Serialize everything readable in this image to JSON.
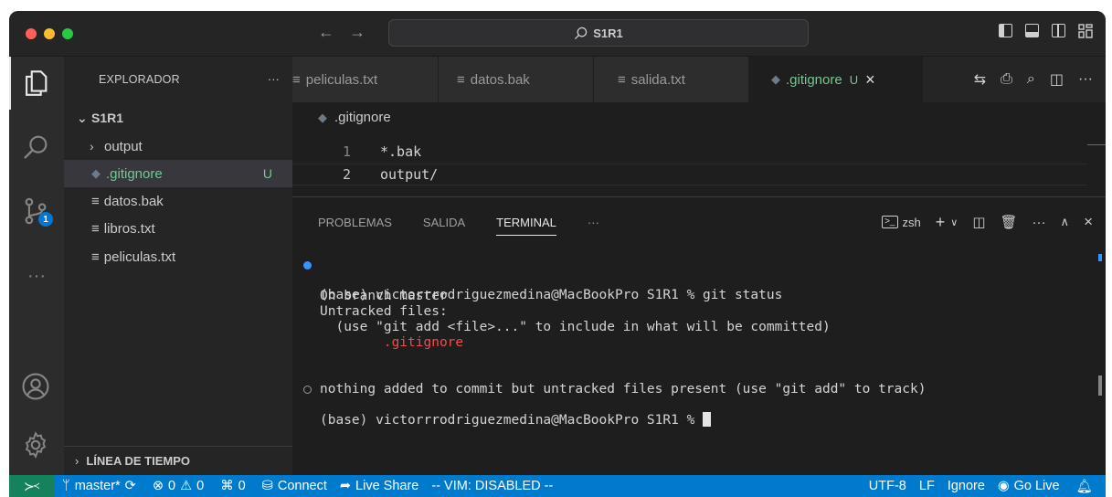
{
  "window": {
    "traffic_colors": [
      "#ff5f57",
      "#febc2e",
      "#28c840"
    ],
    "search_text": "S1R1"
  },
  "sidebar": {
    "title": "EXPLORADOR",
    "more": "···",
    "root": "S1R1",
    "items": [
      {
        "label": "output",
        "type": "folder"
      },
      {
        "label": ".gitignore",
        "type": "git",
        "badge": "U"
      },
      {
        "label": "datos.bak",
        "type": "file"
      },
      {
        "label": "libros.txt",
        "type": "file"
      },
      {
        "label": "peliculas.txt",
        "type": "file"
      }
    ],
    "timeline": "LÍNEA DE TIEMPO"
  },
  "activity": {
    "scm_badge": "1"
  },
  "tabs": [
    {
      "label": "peliculas.txt"
    },
    {
      "label": "datos.bak"
    },
    {
      "label": "salida.txt"
    },
    {
      "label": ".gitignore",
      "badge": "U",
      "close": "×"
    }
  ],
  "editor": {
    "breadcrumb": ".gitignore",
    "lines": [
      {
        "num": "1",
        "text": "*.bak"
      },
      {
        "num": "2",
        "text": "output/"
      }
    ]
  },
  "panel": {
    "tabs": [
      "PROBLEMAS",
      "SALIDA",
      "TERMINAL",
      "···"
    ],
    "shell": "zsh",
    "terminal": {
      "line1": "(base) victorrrodriguezmedina@MacBookPro S1R1 % git status",
      "line2": "On branch master",
      "line3": "Untracked files:",
      "line4": "  (use \"git add <file>...\" to include in what will be committed)",
      "line5": "        .gitignore",
      "line6": "nothing added to commit but untracked files present (use \"git add\" to track)",
      "line7": "(base) victorrrodriguezmedina@MacBookPro S1R1 % "
    }
  },
  "statusbar": {
    "branch": "master*",
    "errors": "0",
    "warnings": "0",
    "ports": "0",
    "connect": "Connect",
    "live_share": "Live Share",
    "vim": "-- VIM: DISABLED --",
    "encoding": "UTF-8",
    "eol": "LF",
    "ignore": "Ignore",
    "go_live": "Go Live"
  },
  "colors": {
    "accent": "#007acc",
    "git_untracked": "#73c991",
    "terminal_red": "#f14c4c"
  }
}
